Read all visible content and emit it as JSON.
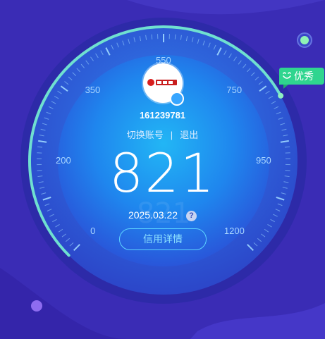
{
  "user": {
    "id": "161239781"
  },
  "account": {
    "switch_label": "切换账号",
    "separator": "|",
    "logout_label": "退出"
  },
  "score": {
    "value": "821",
    "date": "2025.03.22",
    "help": "?"
  },
  "detail_button": {
    "label": "信用详情"
  },
  "rating": {
    "label": "优秀"
  },
  "gauge": {
    "min": 0,
    "max": 1200,
    "current": 821,
    "tick_labels": [
      "0",
      "200",
      "350",
      "550",
      "750",
      "950",
      "1200"
    ]
  },
  "colors": {
    "accent": "#2fd58f",
    "ring": "#6fe0d0",
    "background": "#3d2fb8",
    "dial": "#1d7ff0"
  }
}
